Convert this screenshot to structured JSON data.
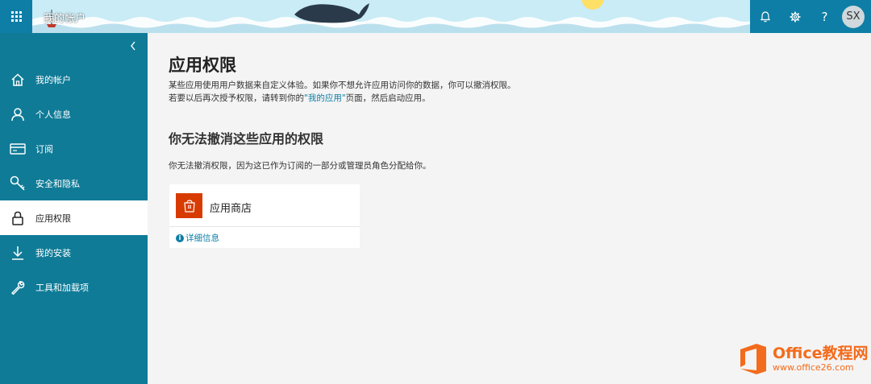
{
  "topbar": {
    "app_title": "我的帐户",
    "avatar_initials": "SX",
    "help_glyph": "?"
  },
  "sidebar": {
    "items": [
      {
        "label": "我的帐户",
        "icon": "home-icon"
      },
      {
        "label": "个人信息",
        "icon": "person-icon"
      },
      {
        "label": "订阅",
        "icon": "card-icon"
      },
      {
        "label": "安全和隐私",
        "icon": "key-icon"
      },
      {
        "label": "应用权限",
        "icon": "lock-icon",
        "active": true
      },
      {
        "label": "我的安装",
        "icon": "download-icon"
      },
      {
        "label": "工具和加载项",
        "icon": "wrench-icon"
      }
    ]
  },
  "main": {
    "title": "应用权限",
    "desc_line1": "某些应用使用用户数据来自定义体验。如果你不想允许应用访问你的数据，你可以撤消权限。",
    "desc_line2_pre": "若要以后再次授予权限，请转到你的",
    "desc_line2_link": "\"我的应用\"",
    "desc_line2_post": "页面，然后启动应用。",
    "section_title": "你无法撤消这些应用的权限",
    "section_note": "你无法撤消权限，因为这已作为订阅的一部分或管理员角色分配给你。",
    "card": {
      "name": "应用商店",
      "details_link": "详细信息",
      "info_glyph": "i"
    }
  },
  "watermark": {
    "top": "Office教程网",
    "bottom": "www.office26.com"
  },
  "colors": {
    "sidebar": "#0f7b97",
    "accent": "#0e7ea6",
    "store_icon": "#d83b01",
    "watermark": "#f36b1c"
  }
}
